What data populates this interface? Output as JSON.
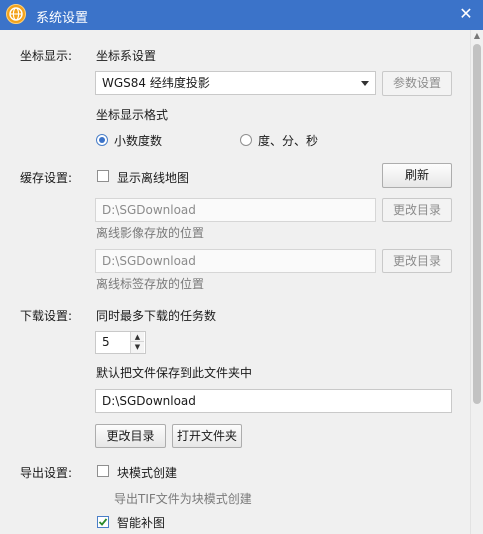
{
  "window": {
    "title": "系统设置",
    "close_glyph": "✕"
  },
  "coords": {
    "section_label": "坐标显示:",
    "system_label": "坐标系设置",
    "system_value": "WGS84 经纬度投影",
    "params_button": "参数设置",
    "format_label": "坐标显示格式",
    "format_option_decimal": "小数度数",
    "format_option_dms": "度、分、秒",
    "selected_format": "小数度数"
  },
  "cache": {
    "section_label": "缓存设置:",
    "show_offline_label": "显示离线地图",
    "show_offline_checked": false,
    "refresh_button": "刷新",
    "image_path": "D:\\SGDownload",
    "image_change_button": "更改目录",
    "image_hint": "离线影像存放的位置",
    "label_path": "D:\\SGDownload",
    "label_change_button": "更改目录",
    "label_hint": "离线标签存放的位置"
  },
  "download": {
    "section_label": "下载设置:",
    "max_tasks_label": "同时最多下载的任务数",
    "max_tasks_value": "5",
    "save_folder_label": "默认把文件保存到此文件夹中",
    "save_folder_path": "D:\\SGDownload",
    "change_dir_button": "更改目录",
    "open_folder_button": "打开文件夹"
  },
  "export": {
    "section_label": "导出设置:",
    "block_mode_label": "块模式创建",
    "block_mode_checked": false,
    "block_mode_hint": "导出TIF文件为块模式创建",
    "smart_fill_label": "智能补图",
    "smart_fill_checked": true
  },
  "colors": {
    "titlebar": "#3b73c9",
    "background": "#f0f0f0",
    "accent": "#3b73c9"
  },
  "icons": {
    "logo": "globe-logo-icon",
    "close": "close-icon",
    "dropdown": "chevron-down-icon",
    "spin_up": "spin-up-icon",
    "spin_down": "spin-down-icon",
    "check": "checkmark-icon"
  }
}
